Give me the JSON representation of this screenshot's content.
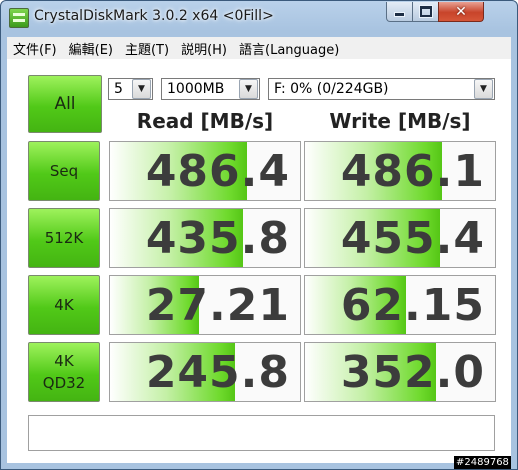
{
  "window": {
    "title": "CrystalDiskMark 3.0.2 x64 <0Fill>",
    "close_glyph": "✕"
  },
  "menu": [
    "文件(F)",
    "編輯(E)",
    "主題(T)",
    "説明(H)",
    "語言(Language)"
  ],
  "controls": {
    "all_label": "All",
    "runs_value": "5",
    "size_value": "1000MB",
    "drive_value": "F: 0% (0/224GB)",
    "dropdown_arrow": "▼"
  },
  "headers": {
    "read": "Read [MB/s]",
    "write": "Write [MB/s]"
  },
  "rows": [
    {
      "label": "Seq",
      "read": "486.4",
      "write": "486.1",
      "read_fill": 0.72,
      "write_fill": 0.72
    },
    {
      "label": "512K",
      "read": "435.8",
      "write": "455.4",
      "read_fill": 0.7,
      "write_fill": 0.71
    },
    {
      "label": "4K",
      "read": "27.21",
      "write": "62.15",
      "read_fill": 0.47,
      "write_fill": 0.53
    },
    {
      "label": "4K\nQD32",
      "read": "245.8",
      "write": "352.0",
      "read_fill": 0.66,
      "write_fill": 0.69
    }
  ],
  "status_text": "",
  "watermark": "#2489768",
  "colors": {
    "accent_green": "#51c918",
    "window_frame": "#a8c3e0",
    "value_text": "#3c3c3c"
  }
}
